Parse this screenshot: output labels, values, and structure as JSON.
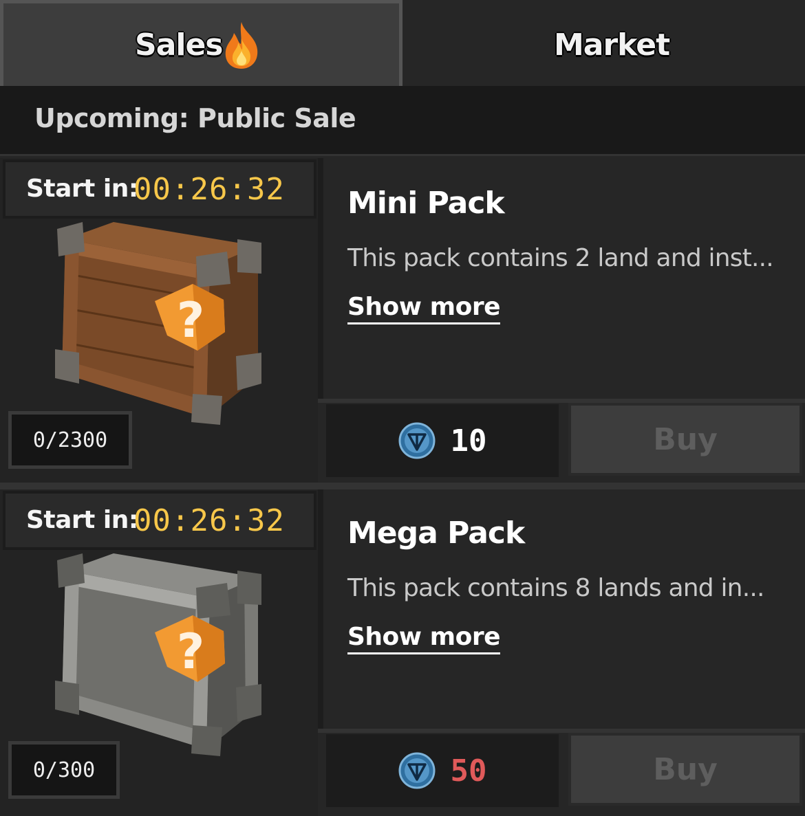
{
  "tabs": {
    "sales_label": "Sales",
    "market_label": "Market"
  },
  "banner": {
    "text": "Upcoming: Public Sale"
  },
  "packs": [
    {
      "start_label": "Start in:",
      "timer": "00:26:32",
      "count": "0/2300",
      "title": "Mini Pack",
      "description": "This pack contains 2 land and inst...",
      "show_more": "Show more",
      "price": "10",
      "price_color": "#ffffff",
      "buy_label": "Buy",
      "crate": "wooden-crate"
    },
    {
      "start_label": "Start in:",
      "timer": "00:26:32",
      "count": "0/300",
      "title": "Mega Pack",
      "description": "This pack contains 8 lands and in...",
      "show_more": "Show more",
      "price": "50",
      "price_color": "#e05a5a",
      "buy_label": "Buy",
      "crate": "metal-crate"
    }
  ],
  "colors": {
    "timer": "#f7c74a",
    "background": "#262626"
  }
}
